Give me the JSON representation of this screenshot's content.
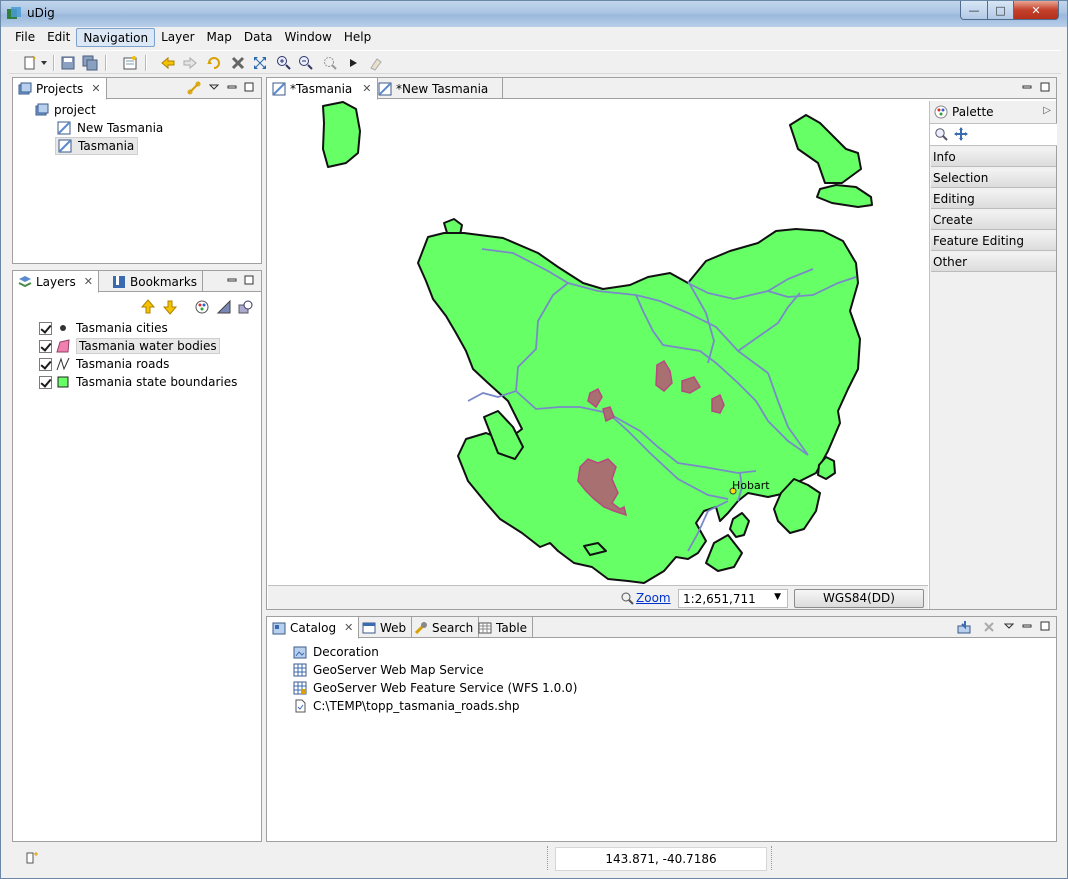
{
  "window": {
    "title": "uDig"
  },
  "menu": [
    "File",
    "Edit",
    "Navigation",
    "Layer",
    "Map",
    "Data",
    "Window",
    "Help"
  ],
  "menu_selected": "Navigation",
  "projects": {
    "tab_label": "Projects",
    "project_name": "project",
    "maps": [
      "New Tasmania",
      "Tasmania"
    ],
    "selected_map": "Tasmania"
  },
  "layers_panel": {
    "tab_label": "Layers",
    "bookmarks_label": "Bookmarks",
    "layers": [
      {
        "name": "Tasmania cities",
        "checked": true,
        "icon": "point-icon"
      },
      {
        "name": "Tasmania water bodies",
        "checked": true,
        "icon": "polygon-icon"
      },
      {
        "name": "Tasmania roads",
        "checked": true,
        "icon": "line-icon"
      },
      {
        "name": "Tasmania state boundaries",
        "checked": true,
        "icon": "square-icon"
      }
    ],
    "selected_layer": "Tasmania water bodies"
  },
  "editor_tabs": [
    {
      "label": "*Tasmania",
      "active": true
    },
    {
      "label": "*New Tasmania",
      "active": false
    }
  ],
  "map": {
    "city_label": "Hobart",
    "zoom_link": "Zoom",
    "scale": "1:2,651,711",
    "crs": "WGS84(DD)",
    "colors": {
      "land": "#66ff66",
      "water": "#a87070",
      "roads": "#7a8ac8",
      "background": "#ffffff"
    }
  },
  "palette": {
    "title": "Palette",
    "categories": [
      "Info",
      "Selection",
      "Editing",
      "Create",
      "Feature Editing",
      "Other"
    ]
  },
  "bottom_tabs": [
    {
      "label": "Catalog",
      "active": true
    },
    {
      "label": "Web",
      "active": false
    },
    {
      "label": "Search",
      "active": false
    },
    {
      "label": "Table",
      "active": false
    }
  ],
  "catalog": [
    "Decoration",
    "GeoServer Web Map Service",
    "GeoServer Web Feature Service (WFS 1.0.0)",
    "C:\\TEMP\\topp_tasmania_roads.shp"
  ],
  "status": {
    "coordinates": "143.871, -40.7186"
  }
}
